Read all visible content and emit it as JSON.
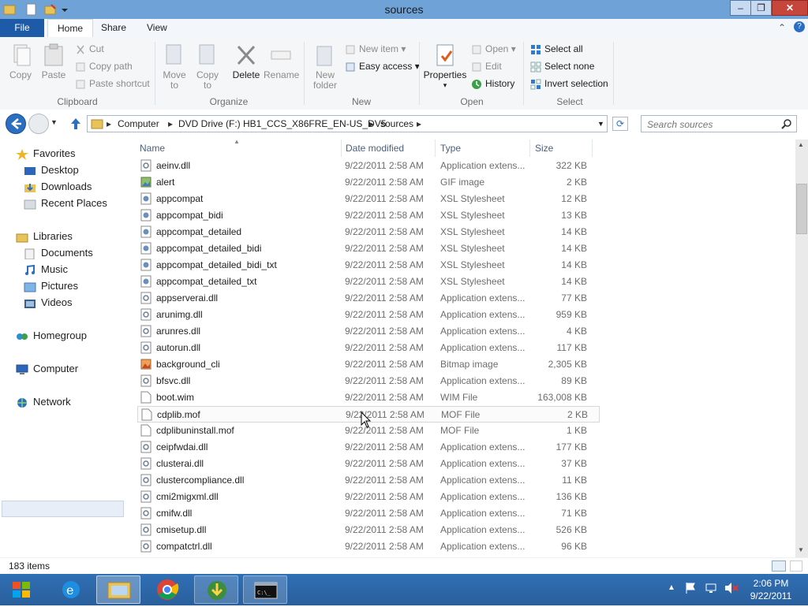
{
  "window": {
    "title": "sources",
    "controls": {
      "minimize": "–",
      "maximize": "❐",
      "close": "✕"
    }
  },
  "ribbon": {
    "tabs": {
      "file": "File",
      "home": "Home",
      "share": "Share",
      "view": "View"
    },
    "clipboard": {
      "group": "Clipboard",
      "copy": "Copy",
      "paste": "Paste",
      "cut": "Cut",
      "copy_path": "Copy path",
      "paste_shortcut": "Paste shortcut"
    },
    "organize": {
      "group": "Organize",
      "move_to_1": "Move",
      "move_to_2": "to",
      "copy_to_1": "Copy",
      "copy_to_2": "to",
      "delete": "Delete",
      "rename": "Rename"
    },
    "new": {
      "group": "New",
      "new_folder_1": "New",
      "new_folder_2": "folder",
      "new_item": "New item",
      "easy_access": "Easy access"
    },
    "open": {
      "group": "Open",
      "properties": "Properties",
      "open": "Open",
      "edit": "Edit",
      "history": "History"
    },
    "select": {
      "group": "Select",
      "select_all": "Select all",
      "select_none": "Select none",
      "invert_selection": "Invert selection"
    }
  },
  "address": {
    "crumbs": [
      "Computer",
      "DVD Drive (F:) HB1_CCS_X86FRE_EN-US_DV5",
      "sources"
    ],
    "search_placeholder": "Search sources"
  },
  "nav_pane": {
    "favorites": "Favorites",
    "desktop": "Desktop",
    "downloads": "Downloads",
    "recent_places": "Recent Places",
    "libraries": "Libraries",
    "documents": "Documents",
    "music": "Music",
    "pictures": "Pictures",
    "videos": "Videos",
    "homegroup": "Homegroup",
    "computer": "Computer",
    "network": "Network"
  },
  "columns": {
    "name": "Name",
    "date": "Date modified",
    "type": "Type",
    "size": "Size"
  },
  "files": [
    {
      "name": "aeinv.dll",
      "date": "9/22/2011 2:58 AM",
      "type": "Application extens...",
      "size": "322 KB",
      "icon": "dll"
    },
    {
      "name": "alert",
      "date": "9/22/2011 2:58 AM",
      "type": "GIF image",
      "size": "2 KB",
      "icon": "gif"
    },
    {
      "name": "appcompat",
      "date": "9/22/2011 2:58 AM",
      "type": "XSL Stylesheet",
      "size": "12 KB",
      "icon": "xsl"
    },
    {
      "name": "appcompat_bidi",
      "date": "9/22/2011 2:58 AM",
      "type": "XSL Stylesheet",
      "size": "13 KB",
      "icon": "xsl"
    },
    {
      "name": "appcompat_detailed",
      "date": "9/22/2011 2:58 AM",
      "type": "XSL Stylesheet",
      "size": "14 KB",
      "icon": "xsl"
    },
    {
      "name": "appcompat_detailed_bidi",
      "date": "9/22/2011 2:58 AM",
      "type": "XSL Stylesheet",
      "size": "14 KB",
      "icon": "xsl"
    },
    {
      "name": "appcompat_detailed_bidi_txt",
      "date": "9/22/2011 2:58 AM",
      "type": "XSL Stylesheet",
      "size": "14 KB",
      "icon": "xsl"
    },
    {
      "name": "appcompat_detailed_txt",
      "date": "9/22/2011 2:58 AM",
      "type": "XSL Stylesheet",
      "size": "14 KB",
      "icon": "xsl"
    },
    {
      "name": "appserverai.dll",
      "date": "9/22/2011 2:58 AM",
      "type": "Application extens...",
      "size": "77 KB",
      "icon": "dll"
    },
    {
      "name": "arunimg.dll",
      "date": "9/22/2011 2:58 AM",
      "type": "Application extens...",
      "size": "959 KB",
      "icon": "dll"
    },
    {
      "name": "arunres.dll",
      "date": "9/22/2011 2:58 AM",
      "type": "Application extens...",
      "size": "4 KB",
      "icon": "dll"
    },
    {
      "name": "autorun.dll",
      "date": "9/22/2011 2:58 AM",
      "type": "Application extens...",
      "size": "117 KB",
      "icon": "dll"
    },
    {
      "name": "background_cli",
      "date": "9/22/2011 2:58 AM",
      "type": "Bitmap image",
      "size": "2,305 KB",
      "icon": "bmp"
    },
    {
      "name": "bfsvc.dll",
      "date": "9/22/2011 2:58 AM",
      "type": "Application extens...",
      "size": "89 KB",
      "icon": "dll"
    },
    {
      "name": "boot.wim",
      "date": "9/22/2011 2:58 AM",
      "type": "WIM File",
      "size": "163,008 KB",
      "icon": "file"
    },
    {
      "name": "cdplib.mof",
      "date": "9/22/2011 2:58 AM",
      "type": "MOF File",
      "size": "2 KB",
      "icon": "file",
      "hover": true
    },
    {
      "name": "cdplibuninstall.mof",
      "date": "9/22/2011 2:58 AM",
      "type": "MOF File",
      "size": "1 KB",
      "icon": "file"
    },
    {
      "name": "ceipfwdai.dll",
      "date": "9/22/2011 2:58 AM",
      "type": "Application extens...",
      "size": "177 KB",
      "icon": "dll"
    },
    {
      "name": "clusterai.dll",
      "date": "9/22/2011 2:58 AM",
      "type": "Application extens...",
      "size": "37 KB",
      "icon": "dll"
    },
    {
      "name": "clustercompliance.dll",
      "date": "9/22/2011 2:58 AM",
      "type": "Application extens...",
      "size": "11 KB",
      "icon": "dll"
    },
    {
      "name": "cmi2migxml.dll",
      "date": "9/22/2011 2:58 AM",
      "type": "Application extens...",
      "size": "136 KB",
      "icon": "dll"
    },
    {
      "name": "cmifw.dll",
      "date": "9/22/2011 2:58 AM",
      "type": "Application extens...",
      "size": "71 KB",
      "icon": "dll"
    },
    {
      "name": "cmisetup.dll",
      "date": "9/22/2011 2:58 AM",
      "type": "Application extens...",
      "size": "526 KB",
      "icon": "dll"
    },
    {
      "name": "compatctrl.dll",
      "date": "9/22/2011 2:58 AM",
      "type": "Application extens...",
      "size": "96 KB",
      "icon": "dll"
    }
  ],
  "status": {
    "item_count": "183 items"
  },
  "taskbar": {
    "apps": [
      "start-icon",
      "ie-icon",
      "file-explorer-icon",
      "chrome-icon",
      "download-manager-icon",
      "command-prompt-icon"
    ],
    "time": "2:06 PM",
    "date": "9/22/2011"
  }
}
